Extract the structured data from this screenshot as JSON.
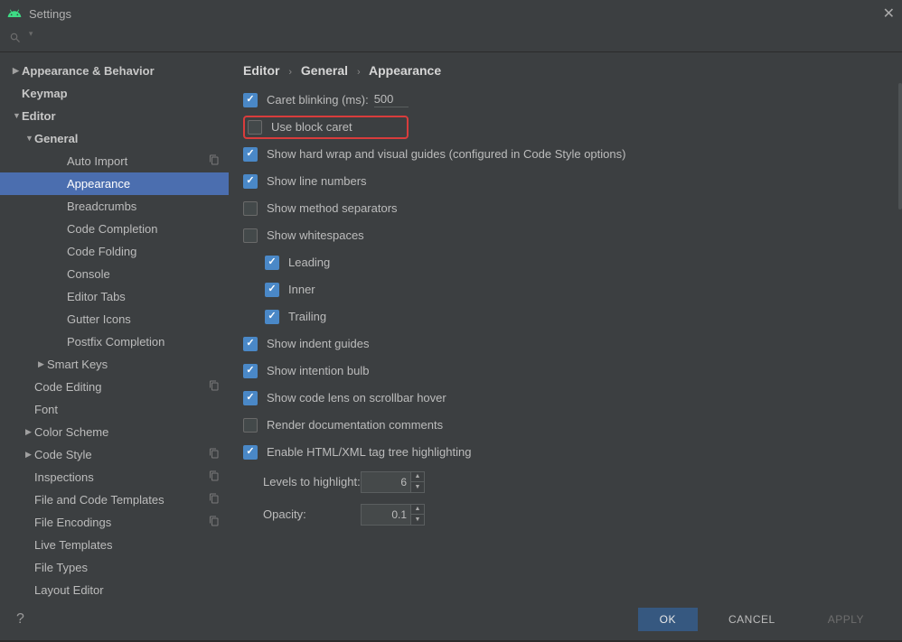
{
  "title": "Settings",
  "breadcrumb": {
    "a": "Editor",
    "b": "General",
    "c": "Appearance"
  },
  "sidebar": [
    {
      "l": "Appearance & Behavior",
      "ind": 0,
      "caret": "right",
      "bold": true
    },
    {
      "l": "Keymap",
      "ind": 0,
      "caret": "none",
      "bold": true
    },
    {
      "l": "Editor",
      "ind": 0,
      "caret": "down",
      "bold": true
    },
    {
      "l": "General",
      "ind": 1,
      "caret": "down",
      "bold": true
    },
    {
      "l": "Auto Import",
      "ind": 3,
      "caret": "none",
      "copy": true
    },
    {
      "l": "Appearance",
      "ind": 3,
      "caret": "none",
      "selected": true
    },
    {
      "l": "Breadcrumbs",
      "ind": 3,
      "caret": "none"
    },
    {
      "l": "Code Completion",
      "ind": 3,
      "caret": "none"
    },
    {
      "l": "Code Folding",
      "ind": 3,
      "caret": "none"
    },
    {
      "l": "Console",
      "ind": 3,
      "caret": "none"
    },
    {
      "l": "Editor Tabs",
      "ind": 3,
      "caret": "none"
    },
    {
      "l": "Gutter Icons",
      "ind": 3,
      "caret": "none"
    },
    {
      "l": "Postfix Completion",
      "ind": 3,
      "caret": "none"
    },
    {
      "l": "Smart Keys",
      "ind": 2,
      "caret": "right"
    },
    {
      "l": "Code Editing",
      "ind": 1,
      "caret": "none",
      "copy": true
    },
    {
      "l": "Font",
      "ind": 1,
      "caret": "none"
    },
    {
      "l": "Color Scheme",
      "ind": 1,
      "caret": "right"
    },
    {
      "l": "Code Style",
      "ind": 1,
      "caret": "right",
      "copy": true
    },
    {
      "l": "Inspections",
      "ind": 1,
      "caret": "none",
      "copy": true
    },
    {
      "l": "File and Code Templates",
      "ind": 1,
      "caret": "none",
      "copy": true
    },
    {
      "l": "File Encodings",
      "ind": 1,
      "caret": "none",
      "copy": true
    },
    {
      "l": "Live Templates",
      "ind": 1,
      "caret": "none"
    },
    {
      "l": "File Types",
      "ind": 1,
      "caret": "none"
    },
    {
      "l": "Layout Editor",
      "ind": 1,
      "caret": "none"
    }
  ],
  "options": {
    "caret_blinking_label": "Caret blinking (ms):",
    "caret_blinking_value": "500",
    "use_block_caret": "Use block caret",
    "show_hard_wrap": "Show hard wrap and visual guides (configured in Code Style options)",
    "show_line_numbers": "Show line numbers",
    "show_method_separators": "Show method separators",
    "show_whitespaces": "Show whitespaces",
    "leading": "Leading",
    "inner": "Inner",
    "trailing": "Trailing",
    "show_indent_guides": "Show indent guides",
    "show_intention_bulb": "Show intention bulb",
    "show_code_lens": "Show code lens on scrollbar hover",
    "render_doc": "Render documentation comments",
    "enable_html": "Enable HTML/XML tag tree highlighting",
    "levels_label": "Levels to highlight:",
    "levels_value": "6",
    "opacity_label": "Opacity:",
    "opacity_value": "0.1"
  },
  "buttons": {
    "ok": "OK",
    "cancel": "CANCEL",
    "apply": "APPLY"
  }
}
